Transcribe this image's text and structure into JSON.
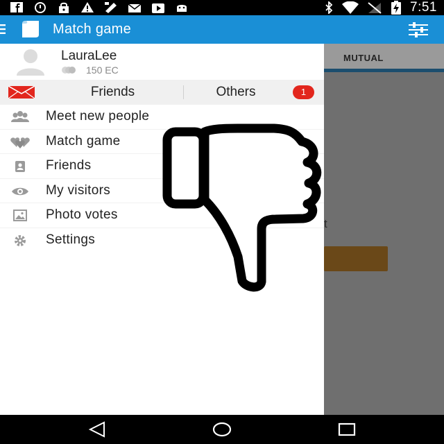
{
  "status_bar": {
    "time": "7:51",
    "icons": [
      "facebook-icon",
      "alarm-icon",
      "lock-icon",
      "warning-icon",
      "app-icon",
      "mail-icon",
      "play-store-icon",
      "android-icon",
      "bluetooth-icon",
      "wifi-icon",
      "no-signal-icon",
      "battery-charging-icon"
    ]
  },
  "app_bar": {
    "title": "Match game",
    "menu_icon": "drawer-menu-icon",
    "logo_icon": "app-logo-icon",
    "filter_icon": "filter-sliders-icon",
    "color": "#1a8fd6"
  },
  "drawer": {
    "profile": {
      "name": "LauraLee",
      "coins": "150 EC"
    },
    "tabs": {
      "friends_label": "Friends",
      "others_label": "Others",
      "others_badge": "1",
      "badge_color": "#e2261d"
    },
    "menu_items": [
      {
        "label": "Meet new people",
        "icon": "people-icon"
      },
      {
        "label": "Match game",
        "icon": "hearts-icon"
      },
      {
        "label": "Friends",
        "icon": "contact-card-icon"
      },
      {
        "label": "My visitors",
        "icon": "eye-icon"
      },
      {
        "label": "Photo votes",
        "icon": "photos-icon"
      },
      {
        "label": "Settings",
        "icon": "gear-icon"
      }
    ]
  },
  "background_screen": {
    "tab_label": "MUTUAL",
    "partial_text": "t"
  },
  "overlay": {
    "icon": "thumbs-down-icon"
  },
  "nav_bar": {
    "icons": [
      "back-icon",
      "home-icon",
      "recents-icon"
    ]
  }
}
